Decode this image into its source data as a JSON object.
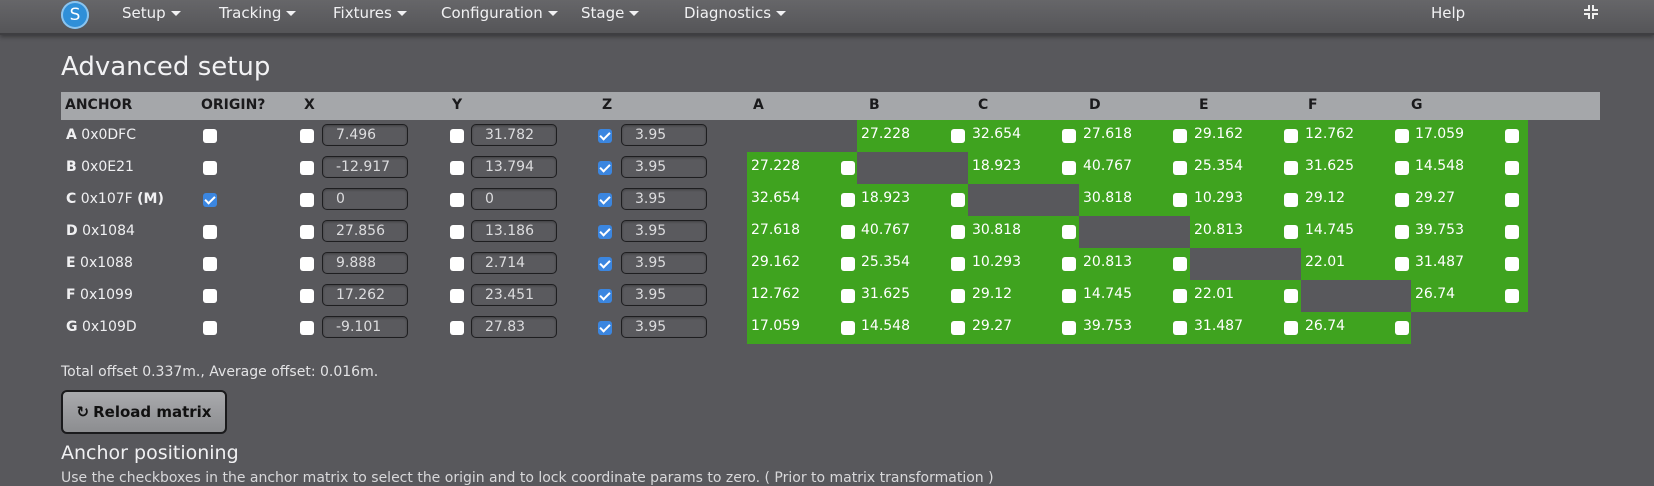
{
  "nav": {
    "logo": "S",
    "menus": [
      "Setup",
      "Tracking",
      "Fixtures",
      "Configuration",
      "Stage",
      "Diagnostics"
    ],
    "help": "Help"
  },
  "title": "Advanced setup",
  "table": {
    "headers": [
      "ANCHOR",
      "ORIGIN?",
      "X",
      "Y",
      "Z",
      "A",
      "B",
      "C",
      "D",
      "E",
      "F",
      "G"
    ],
    "rows": [
      {
        "letter": "A",
        "id": "0x0DFC",
        "suffix": "",
        "origin": false,
        "x": "7.496",
        "y": "31.782",
        "z": "3.95",
        "zlock": true,
        "dist": [
          "",
          "27.228",
          "32.654",
          "27.618",
          "29.162",
          "12.762",
          "17.059"
        ]
      },
      {
        "letter": "B",
        "id": "0x0E21",
        "suffix": "",
        "origin": false,
        "x": "-12.917",
        "y": "13.794",
        "z": "3.95",
        "zlock": true,
        "dist": [
          "27.228",
          "",
          "18.923",
          "40.767",
          "25.354",
          "31.625",
          "14.548"
        ]
      },
      {
        "letter": "C",
        "id": "0x107F",
        "suffix": "(M)",
        "origin": true,
        "x": "0",
        "y": "0",
        "z": "3.95",
        "zlock": true,
        "dist": [
          "32.654",
          "18.923",
          "",
          "30.818",
          "10.293",
          "29.12",
          "29.27"
        ]
      },
      {
        "letter": "D",
        "id": "0x1084",
        "suffix": "",
        "origin": false,
        "x": "27.856",
        "y": "13.186",
        "z": "3.95",
        "zlock": true,
        "dist": [
          "27.618",
          "40.767",
          "30.818",
          "",
          "20.813",
          "14.745",
          "39.753"
        ]
      },
      {
        "letter": "E",
        "id": "0x1088",
        "suffix": "",
        "origin": false,
        "x": "9.888",
        "y": "2.714",
        "z": "3.95",
        "zlock": true,
        "dist": [
          "29.162",
          "25.354",
          "10.293",
          "20.813",
          "",
          "22.01",
          "31.487"
        ]
      },
      {
        "letter": "F",
        "id": "0x1099",
        "suffix": "",
        "origin": false,
        "x": "17.262",
        "y": "23.451",
        "z": "3.95",
        "zlock": true,
        "dist": [
          "12.762",
          "31.625",
          "29.12",
          "14.745",
          "22.01",
          "",
          "26.74"
        ]
      },
      {
        "letter": "G",
        "id": "0x109D",
        "suffix": "",
        "origin": false,
        "x": "-9.101",
        "y": "27.83",
        "z": "3.95",
        "zlock": true,
        "dist": [
          "17.059",
          "14.548",
          "29.27",
          "39.753",
          "31.487",
          "26.74",
          ""
        ]
      }
    ]
  },
  "summary": "Total offset 0.337m., Average offset: 0.016m.",
  "reload_button": "Reload matrix",
  "section_title": "Anchor positioning",
  "help_text": "Use the checkboxes in the anchor matrix to select the origin and to lock coordinate params to zero. ( Prior to matrix transformation )",
  "colors": {
    "distance_cell": "#3fa31f",
    "header": "#a5a7aa",
    "background": "#58585c"
  }
}
